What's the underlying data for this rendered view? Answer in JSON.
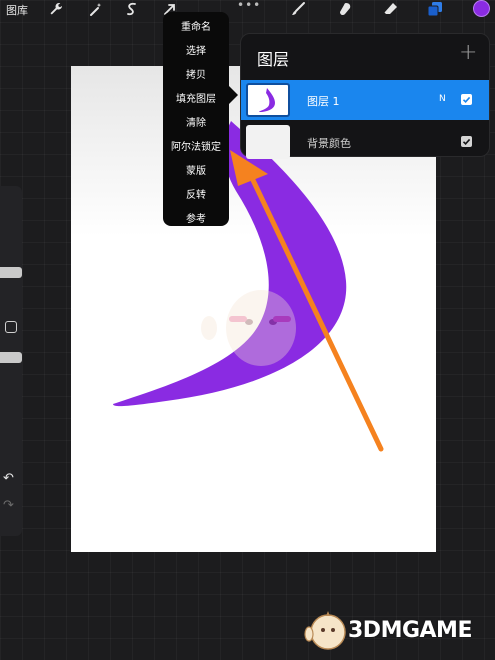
{
  "toolbar": {
    "gallery_label": "图库",
    "left_tools": [
      "wrench-icon",
      "magic-wand-icon",
      "selection-icon",
      "transform-arrow-icon"
    ],
    "right_tools": [
      "brush-icon",
      "smudge-icon",
      "eraser-icon",
      "layers-icon"
    ],
    "current_color": "#8a2be2"
  },
  "context_menu": {
    "items": [
      "重命名",
      "选择",
      "拷贝",
      "填充图层",
      "清除",
      "阿尔法锁定",
      "蒙版",
      "反转",
      "参考"
    ]
  },
  "layers_panel": {
    "title": "图层",
    "add_symbol": "+",
    "layers": [
      {
        "name": "图层 1",
        "blend_mode": "N",
        "visible": true,
        "selected": true
      },
      {
        "name": "背景颜色",
        "blend_mode": "",
        "visible": true,
        "selected": false
      }
    ]
  },
  "colors": {
    "stroke_purple": "#8a2be2",
    "selection_blue": "#1a86ee",
    "annotation_arrow": "#f5821f"
  },
  "watermark": {
    "text": "3DMGAME"
  }
}
